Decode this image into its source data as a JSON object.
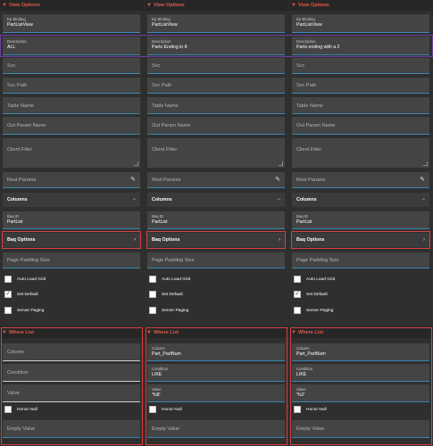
{
  "col1": {
    "view": {
      "title": "View Options",
      "ep_binding": {
        "label": "Ep Binding",
        "value": "PartListView"
      },
      "description": {
        "label": "Description",
        "value": "ALL"
      },
      "svc": "Svc",
      "svc_path": "Svc Path",
      "table_name": "Table Name",
      "out_param": "Out Param Name",
      "client_filter": "Client Filter",
      "rest_params": "Rest Params",
      "columns": "Columns",
      "baq_id": {
        "label": "Baq ID",
        "value": "PartList"
      },
      "baq_options": "Baq Options",
      "page_padding": "Page Padding Size",
      "auto_load_grid": "Auto Load Grid",
      "set_default": "Set Default",
      "server_paging": "Server Paging",
      "set_default_checked": true
    },
    "where": {
      "title": "Where List",
      "column": {
        "label": "Column",
        "value": ""
      },
      "condition": {
        "label": "Condition",
        "value": ""
      },
      "value": {
        "label": "Value",
        "value": ""
      },
      "honor_null": "Honor Null",
      "empty_value": "Empty Value"
    }
  },
  "col2": {
    "view": {
      "title": "View Options",
      "ep_binding": {
        "label": "Ep Binding",
        "value": "PartListView"
      },
      "description": {
        "label": "Description",
        "value": "Parts Ending in 8"
      },
      "svc": "Svc",
      "svc_path": "Svc Path",
      "table_name": "Table Name",
      "out_param": "Out Param Name",
      "client_filter": "Client Filter",
      "rest_params": "Rest Params",
      "columns": "Columns",
      "baq_id": {
        "label": "Baq ID",
        "value": "PartList"
      },
      "baq_options": "Baq Options",
      "page_padding": "Page Padding Size",
      "auto_load_grid": "Auto Load Grid",
      "set_default": "Set Default",
      "server_paging": "Server Paging",
      "set_default_checked": false
    },
    "where": {
      "title": "Where List",
      "column": {
        "label": "Column",
        "value": "Part_PartNum"
      },
      "condition": {
        "label": "Condition",
        "value": "LIKE"
      },
      "value": {
        "label": "Value",
        "value": "'%8'"
      },
      "honor_null": "Honor Null",
      "empty_value": "Empty Value"
    }
  },
  "col3": {
    "view": {
      "title": "View Options",
      "ep_binding": {
        "label": "Ep Binding",
        "value": "PartListView"
      },
      "description": {
        "label": "Description",
        "value": "Parts ending with a 2"
      },
      "svc": "Svc",
      "svc_path": "Svc Path",
      "table_name": "Table Name",
      "out_param": "Out Param Name",
      "client_filter": "Client Filter",
      "rest_params": "Rest Params",
      "columns": "Columns",
      "baq_id": {
        "label": "Baq ID",
        "value": "PartList"
      },
      "baq_options": "Baq Options",
      "page_padding": "Page Padding Size",
      "auto_load_grid": "Auto Load Grid",
      "set_default": "Set Default",
      "server_paging": "Server Paging",
      "set_default_checked": true
    },
    "where": {
      "title": "Where List",
      "column": {
        "label": "Column",
        "value": "Part_PartNum"
      },
      "condition": {
        "label": "Condition",
        "value": "LIKE"
      },
      "value": {
        "label": "Value",
        "value": "'%2'"
      },
      "honor_null": "Honor Null",
      "empty_value": "Empty Value"
    }
  },
  "icons": {
    "pencil": "pencil-icon",
    "minus": "minus-icon",
    "chevron": "chevron-right-icon",
    "check": "check-icon"
  },
  "colors": {
    "accent_red": "#d94040",
    "header_text": "#e05a4a",
    "purple": "#6e3fa3",
    "field_underline": "#3a86b4"
  }
}
